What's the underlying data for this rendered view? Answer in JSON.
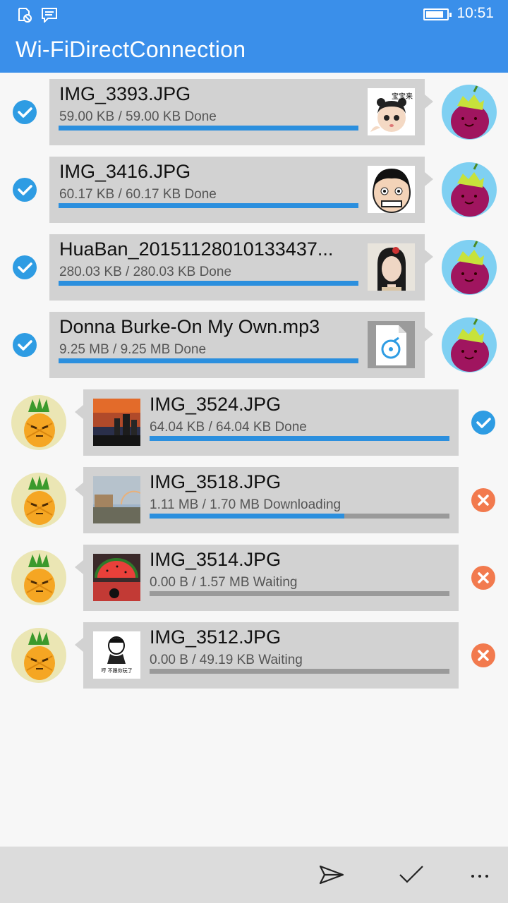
{
  "status_bar": {
    "time": "10:51"
  },
  "app": {
    "title": "Wi-FiDirectConnection"
  },
  "transfers": [
    {
      "name": "IMG_3393.JPG",
      "progress_text": "59.00  KB / 59.00  KB Done",
      "progress": 1.0,
      "status": "done",
      "direction": "sent",
      "thumb": "baby-sticker",
      "thumb_caption": "宝宝来"
    },
    {
      "name": "IMG_3416.JPG",
      "progress_text": "60.17  KB / 60.17  KB Done",
      "progress": 1.0,
      "status": "done",
      "direction": "sent",
      "thumb": "meme-face"
    },
    {
      "name": "HuaBan_20151128010133437...",
      "progress_text": "280.03  KB / 280.03  KB Done",
      "progress": 1.0,
      "status": "done",
      "direction": "sent",
      "thumb": "portrait"
    },
    {
      "name": "Donna Burke-On My Own.mp3",
      "progress_text": "9.25  MB / 9.25  MB Done",
      "progress": 1.0,
      "status": "done",
      "direction": "sent",
      "thumb": "audio-file-icon"
    },
    {
      "name": "IMG_3524.JPG",
      "progress_text": "64.04  KB / 64.04  KB Done",
      "progress": 1.0,
      "status": "done",
      "direction": "received",
      "thumb": "sunset-photo"
    },
    {
      "name": "IMG_3518.JPG",
      "progress_text": "1.11  MB / 1.70  MB Downloading",
      "progress": 0.65,
      "status": "downloading",
      "direction": "received",
      "thumb": "rainbow-photo"
    },
    {
      "name": "IMG_3514.JPG",
      "progress_text": "0.00  B / 1.57  MB Waiting",
      "progress": 0.0,
      "status": "waiting",
      "direction": "received",
      "thumb": "watermelon-photo"
    },
    {
      "name": "IMG_3512.JPG",
      "progress_text": "0.00  B / 49.19  KB Waiting",
      "progress": 0.0,
      "status": "waiting",
      "direction": "received",
      "thumb": "meme-sticker",
      "thumb_caption": "哼 不跟你玩了"
    }
  ],
  "app_bar": {
    "icons": [
      "send-icon",
      "check-icon",
      "more-icon"
    ]
  },
  "colors": {
    "accent": "#3a8fea",
    "progress": "#2b8fde",
    "done": "#2e9ce3",
    "cancel": "#f27a4e",
    "card": "#d2d2d2"
  }
}
